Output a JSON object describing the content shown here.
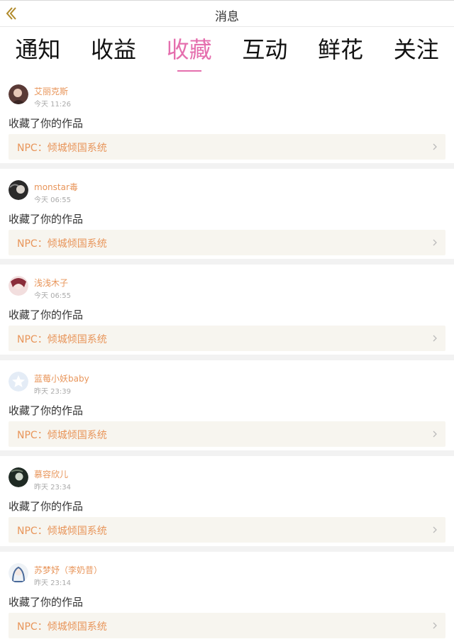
{
  "header": {
    "title": "消息"
  },
  "tabs": [
    {
      "label": "通知"
    },
    {
      "label": "收益"
    },
    {
      "label": "收藏",
      "active": true
    },
    {
      "label": "互动"
    },
    {
      "label": "鲜花"
    },
    {
      "label": "关注"
    }
  ],
  "colors": {
    "accent": "#e56fae",
    "name": "#e8955a",
    "card_bg": "#f7f5ef"
  },
  "messages": [
    {
      "user": "艾丽克斯",
      "time": "今天 11:26",
      "action": "收藏了你的作品",
      "work": "NPC：倾城倾国系统"
    },
    {
      "user": "monstar毒",
      "time": "今天 06:55",
      "action": "收藏了你的作品",
      "work": "NPC：倾城倾国系统"
    },
    {
      "user": "浅浅木子",
      "time": "今天 06:55",
      "action": "收藏了你的作品",
      "work": "NPC：倾城倾国系统"
    },
    {
      "user": "蓝莓小妖baby",
      "time": "昨天 23:39",
      "action": "收藏了你的作品",
      "work": "NPC：倾城倾国系统"
    },
    {
      "user": "慕容欣儿",
      "time": "昨天 23:34",
      "action": "收藏了你的作品",
      "work": "NPC：倾城倾国系统"
    },
    {
      "user": "苏梦妤（李奶昔）",
      "time": "昨天 23:14",
      "action": "收藏了你的作品",
      "work": "NPC：倾城倾国系统"
    }
  ]
}
